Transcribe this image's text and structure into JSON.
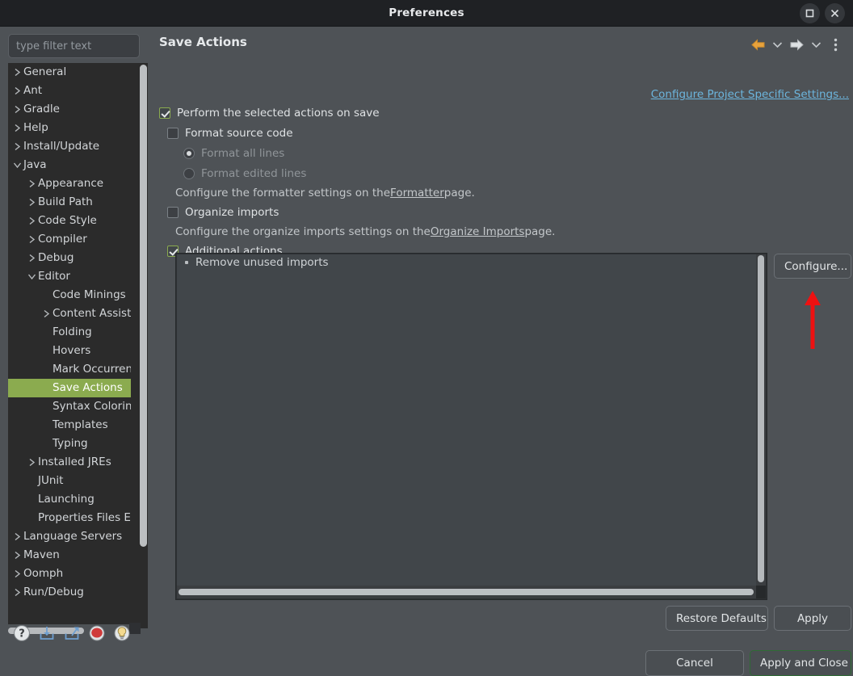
{
  "window": {
    "title": "Preferences",
    "maximize_label": "Maximize",
    "close_label": "Close"
  },
  "sidebar": {
    "filter_placeholder": "type filter text",
    "filter_value": "",
    "items": [
      {
        "label": "General",
        "indent": 0,
        "twisty": "collapsed",
        "selected": false
      },
      {
        "label": "Ant",
        "indent": 0,
        "twisty": "collapsed",
        "selected": false
      },
      {
        "label": "Gradle",
        "indent": 0,
        "twisty": "collapsed",
        "selected": false
      },
      {
        "label": "Help",
        "indent": 0,
        "twisty": "collapsed",
        "selected": false
      },
      {
        "label": "Install/Update",
        "indent": 0,
        "twisty": "collapsed",
        "selected": false
      },
      {
        "label": "Java",
        "indent": 0,
        "twisty": "expanded",
        "selected": false
      },
      {
        "label": "Appearance",
        "indent": 1,
        "twisty": "collapsed",
        "selected": false
      },
      {
        "label": "Build Path",
        "indent": 1,
        "twisty": "collapsed",
        "selected": false
      },
      {
        "label": "Code Style",
        "indent": 1,
        "twisty": "collapsed",
        "selected": false
      },
      {
        "label": "Compiler",
        "indent": 1,
        "twisty": "collapsed",
        "selected": false
      },
      {
        "label": "Debug",
        "indent": 1,
        "twisty": "collapsed",
        "selected": false
      },
      {
        "label": "Editor",
        "indent": 1,
        "twisty": "expanded",
        "selected": false
      },
      {
        "label": "Code Minings",
        "indent": 2,
        "twisty": "none",
        "selected": false
      },
      {
        "label": "Content Assist",
        "indent": 2,
        "twisty": "collapsed",
        "selected": false
      },
      {
        "label": "Folding",
        "indent": 2,
        "twisty": "none",
        "selected": false
      },
      {
        "label": "Hovers",
        "indent": 2,
        "twisty": "none",
        "selected": false
      },
      {
        "label": "Mark Occurrences",
        "indent": 2,
        "twisty": "none",
        "selected": false
      },
      {
        "label": "Save Actions",
        "indent": 2,
        "twisty": "none",
        "selected": true
      },
      {
        "label": "Syntax Coloring",
        "indent": 2,
        "twisty": "none",
        "selected": false
      },
      {
        "label": "Templates",
        "indent": 2,
        "twisty": "none",
        "selected": false
      },
      {
        "label": "Typing",
        "indent": 2,
        "twisty": "none",
        "selected": false
      },
      {
        "label": "Installed JREs",
        "indent": 1,
        "twisty": "collapsed",
        "selected": false
      },
      {
        "label": "JUnit",
        "indent": 1,
        "twisty": "none",
        "selected": false
      },
      {
        "label": "Launching",
        "indent": 1,
        "twisty": "none",
        "selected": false
      },
      {
        "label": "Properties Files Editor",
        "indent": 1,
        "twisty": "none",
        "selected": false
      },
      {
        "label": "Language Servers",
        "indent": 0,
        "twisty": "collapsed",
        "selected": false
      },
      {
        "label": "Maven",
        "indent": 0,
        "twisty": "collapsed",
        "selected": false
      },
      {
        "label": "Oomph",
        "indent": 0,
        "twisty": "collapsed",
        "selected": false
      },
      {
        "label": "Run/Debug",
        "indent": 0,
        "twisty": "collapsed",
        "selected": false
      }
    ],
    "bottom_icons": [
      {
        "name": "help-icon"
      },
      {
        "name": "import-icon"
      },
      {
        "name": "export-icon"
      },
      {
        "name": "record-icon"
      },
      {
        "name": "lightbulb-icon"
      }
    ]
  },
  "header": {
    "title": "Save Actions",
    "back_label": "Back",
    "forward_label": "Forward",
    "menu_label": "View Menu",
    "project_settings_link": "Configure Project Specific Settings..."
  },
  "form": {
    "perform_on_save": {
      "label": "Perform the selected actions on save",
      "checked": true
    },
    "format_source": {
      "label": "Format source code",
      "checked": false
    },
    "format_all_lines": {
      "label": "Format all lines",
      "selected": true,
      "enabled": false
    },
    "format_edited_lines": {
      "label": "Format edited lines",
      "selected": false,
      "enabled": false
    },
    "formatter_hint": {
      "prefix": "Configure the formatter settings on the ",
      "link": "Formatter",
      "suffix": " page."
    },
    "organize_imports": {
      "label": "Organize imports",
      "checked": false
    },
    "organize_hint": {
      "prefix": "Configure the organize imports settings on the ",
      "link": "Organize Imports",
      "suffix": " page."
    },
    "additional_actions": {
      "label": "Additional actions",
      "checked": true
    },
    "actions_list": [
      "Remove unused imports"
    ],
    "configure_button": "Configure..."
  },
  "footer": {
    "restore_defaults": "Restore Defaults",
    "apply": "Apply",
    "cancel": "Cancel",
    "apply_and_close": "Apply and Close"
  },
  "annotation": {
    "arrow_color": "#ee1111",
    "points_to": "configure-button"
  },
  "colors": {
    "window_bg": "#4e5256",
    "titlebar_bg": "#1f2124",
    "tree_bg": "#2b2b2b",
    "selection_green": "#8bab4f",
    "link_blue": "#6cb5dd",
    "listbox_bg": "#41464a",
    "default_button_border": "#2f6b35"
  }
}
